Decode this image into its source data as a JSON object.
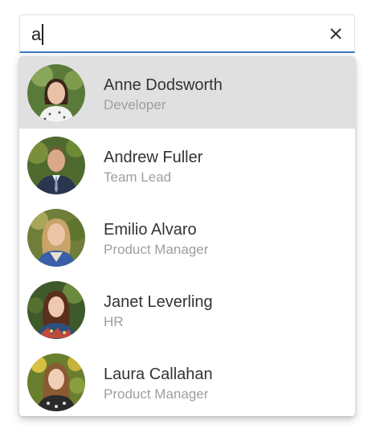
{
  "search": {
    "value": "a"
  },
  "colors": {
    "accent": "#3a78c4",
    "active_row": "#e0e0e0",
    "name_text": "#333333",
    "role_text": "#9e9e9e"
  },
  "results": [
    {
      "name": "Anne Dodsworth",
      "role": "Developer",
      "icon": "avatar-photo",
      "active": true
    },
    {
      "name": "Andrew Fuller",
      "role": "Team Lead",
      "icon": "avatar-photo",
      "active": false
    },
    {
      "name": "Emilio Alvaro",
      "role": "Product Manager",
      "icon": "avatar-photo",
      "active": false
    },
    {
      "name": "Janet Leverling",
      "role": "HR",
      "icon": "avatar-photo",
      "active": false
    },
    {
      "name": "Laura Callahan",
      "role": "Product Manager",
      "icon": "avatar-photo",
      "active": false
    }
  ]
}
